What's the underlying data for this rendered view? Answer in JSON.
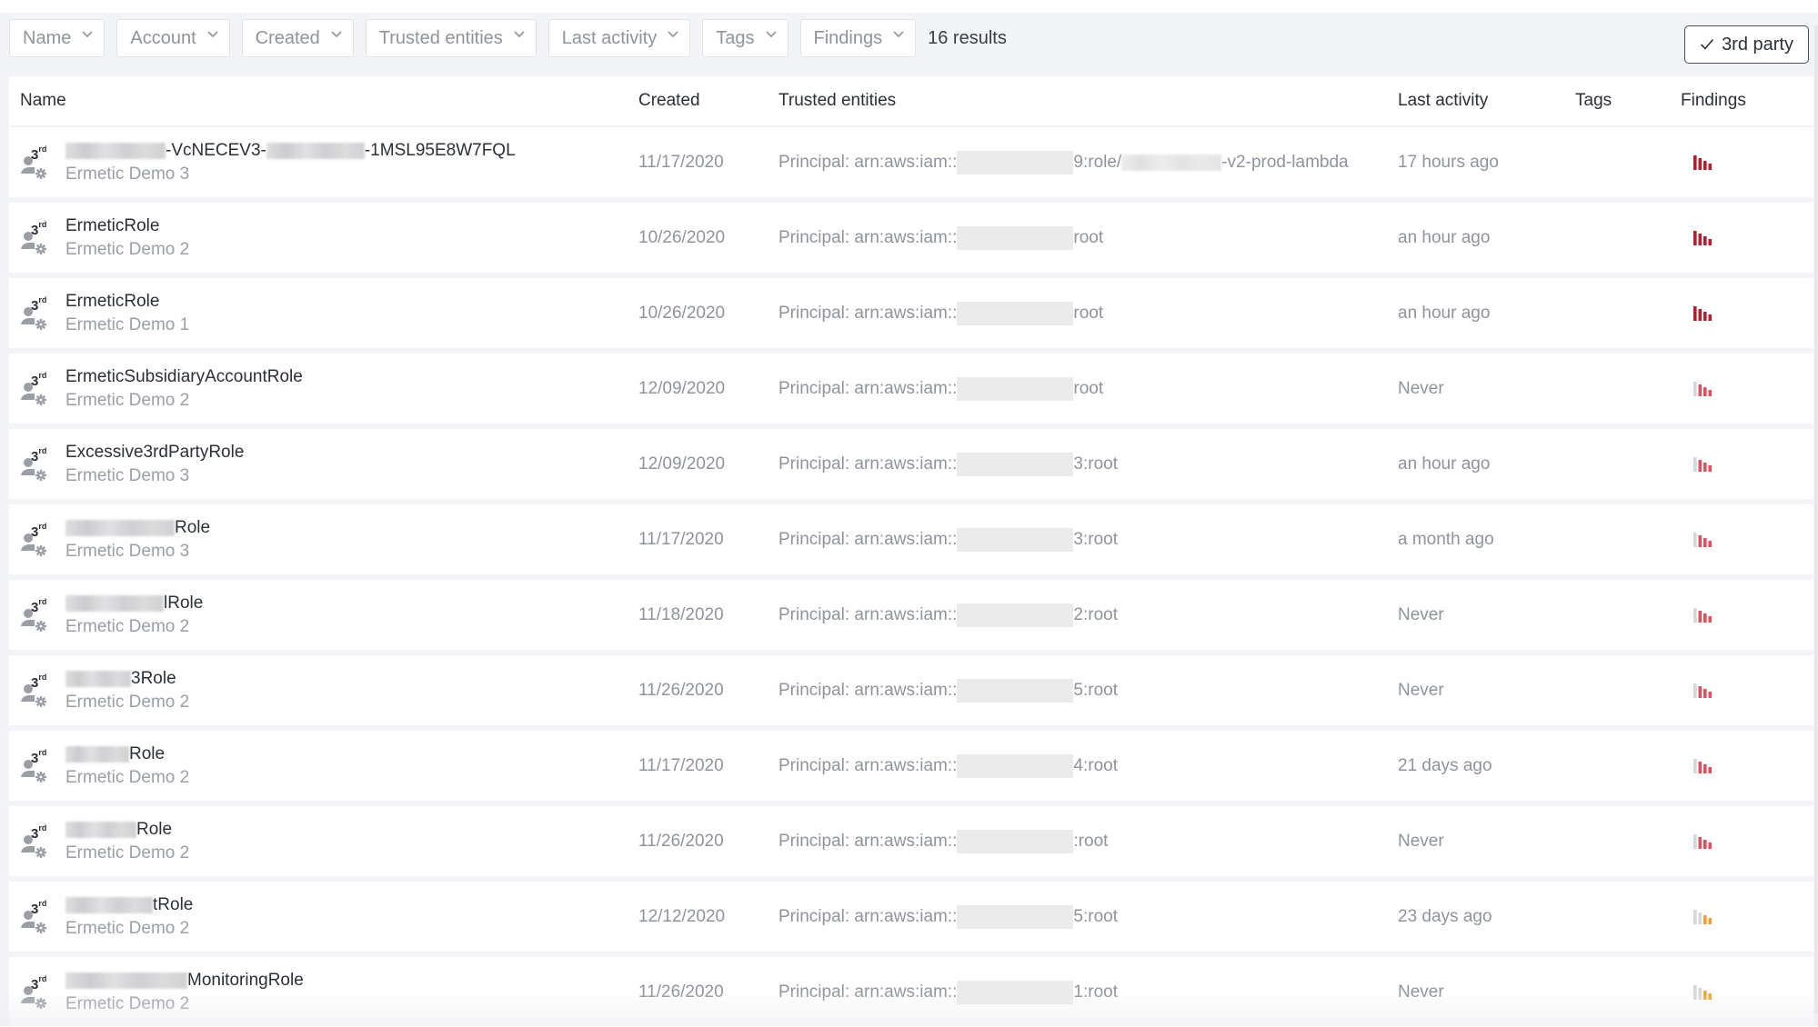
{
  "filters": {
    "items": [
      {
        "label": "Name"
      },
      {
        "label": "Account"
      },
      {
        "label": "Created"
      },
      {
        "label": "Trusted entities"
      },
      {
        "label": "Last activity"
      },
      {
        "label": "Tags"
      },
      {
        "label": "Findings"
      }
    ],
    "results_count": "16 results",
    "toggle_label": "3rd party",
    "toggle_checked": true
  },
  "table": {
    "columns": [
      "Name",
      "Created",
      "Trusted entities",
      "Last activity",
      "Tags",
      "Findings"
    ],
    "icon": "third-party-role-icon",
    "third_label": "3",
    "third_suffix": "rd",
    "rows": [
      {
        "name_prefix_redacted": true,
        "name": "-VcNECEV3-",
        "name_suffix": "-1MSL95E8W7FQL",
        "account": "Ermetic Demo 3",
        "created": "11/17/2020",
        "trust_prefix": "Principal: arn:aws:iam::",
        "trust_suffix": "9:role/",
        "trust_tail": "-v2-prod-lambda",
        "last_activity": "17 hours ago",
        "tags": "",
        "findings_severity": "critical",
        "findings_colors": [
          "#b5202e",
          "#b5202e",
          "#b5202e",
          "#b5202e"
        ]
      },
      {
        "name": "ErmeticRole",
        "account": "Ermetic Demo 2",
        "created": "10/26/2020",
        "trust_prefix": "Principal: arn:aws:iam::",
        "trust_suffix": "root",
        "last_activity": "an hour ago",
        "tags": "",
        "findings_severity": "critical",
        "findings_colors": [
          "#b5202e",
          "#b5202e",
          "#b5202e",
          "#b5202e"
        ]
      },
      {
        "name": "ErmeticRole",
        "account": "Ermetic Demo 1",
        "created": "10/26/2020",
        "trust_prefix": "Principal: arn:aws:iam::",
        "trust_suffix": "root",
        "last_activity": "an hour ago",
        "tags": "",
        "findings_severity": "critical",
        "findings_colors": [
          "#b5202e",
          "#b5202e",
          "#b5202e",
          "#b5202e"
        ]
      },
      {
        "name": "ErmeticSubsidiaryAccountRole",
        "account": "Ermetic Demo 2",
        "created": "12/09/2020",
        "trust_prefix": "Principal: arn:aws:iam::",
        "trust_suffix": "root",
        "last_activity": "Never",
        "tags": "",
        "findings_severity": "high",
        "findings_colors": [
          "#d4d6da",
          "#e0505e",
          "#e0505e",
          "#e0505e"
        ]
      },
      {
        "name": "Excessive3rdPartyRole",
        "account": "Ermetic Demo 3",
        "created": "12/09/2020",
        "trust_prefix": "Principal: arn:aws:iam::",
        "trust_suffix": "3:root",
        "last_activity": "an hour ago",
        "tags": "",
        "findings_severity": "high",
        "findings_colors": [
          "#d4d6da",
          "#e0505e",
          "#e0505e",
          "#e0505e"
        ]
      },
      {
        "name_prefix_redacted": true,
        "name": "Role",
        "account": "Ermetic Demo 3",
        "created": "11/17/2020",
        "trust_prefix": "Principal: arn:aws:iam::",
        "trust_suffix": "3:root",
        "last_activity": "a month ago",
        "tags": "",
        "findings_severity": "high",
        "findings_colors": [
          "#d4d6da",
          "#e0505e",
          "#e0505e",
          "#e0505e"
        ]
      },
      {
        "name_prefix_redacted": true,
        "name": "lRole",
        "account": "Ermetic Demo 2",
        "created": "11/18/2020",
        "trust_prefix": "Principal: arn:aws:iam::",
        "trust_suffix": "2:root",
        "last_activity": "Never",
        "tags": "",
        "findings_severity": "high",
        "findings_colors": [
          "#d4d6da",
          "#e0505e",
          "#e0505e",
          "#e0505e"
        ]
      },
      {
        "name_prefix_redacted": true,
        "name": "3Role",
        "account": "Ermetic Demo 2",
        "created": "11/26/2020",
        "trust_prefix": "Principal: arn:aws:iam::",
        "trust_suffix": "5:root",
        "last_activity": "Never",
        "tags": "",
        "findings_severity": "high",
        "findings_colors": [
          "#d4d6da",
          "#e0505e",
          "#e0505e",
          "#e0505e"
        ]
      },
      {
        "name_prefix_redacted": true,
        "name": "Role",
        "account": "Ermetic Demo 2",
        "created": "11/17/2020",
        "trust_prefix": "Principal: arn:aws:iam::",
        "trust_suffix": "4:root",
        "last_activity": "21 days ago",
        "tags": "",
        "findings_severity": "high",
        "findings_colors": [
          "#d4d6da",
          "#e0505e",
          "#e0505e",
          "#e0505e"
        ]
      },
      {
        "name_prefix_redacted": true,
        "name": "Role",
        "account": "Ermetic Demo 2",
        "created": "11/26/2020",
        "trust_prefix": "Principal: arn:aws:iam::",
        "trust_suffix": ":root",
        "last_activity": "Never",
        "tags": "",
        "findings_severity": "high",
        "findings_colors": [
          "#d4d6da",
          "#e0505e",
          "#e0505e",
          "#e0505e"
        ]
      },
      {
        "name_prefix_redacted": true,
        "name": "tRole",
        "account": "Ermetic Demo 2",
        "created": "12/12/2020",
        "trust_prefix": "Principal: arn:aws:iam::",
        "trust_suffix": "5:root",
        "last_activity": "23 days ago",
        "tags": "",
        "findings_severity": "medium",
        "findings_colors": [
          "#d4d6da",
          "#d4d6da",
          "#f0a030",
          "#f0a030"
        ]
      },
      {
        "name_prefix_redacted": true,
        "name": "MonitoringRole",
        "account": "Ermetic Demo 2",
        "created": "11/26/2020",
        "trust_prefix": "Principal: arn:aws:iam::",
        "trust_suffix": "1:root",
        "last_activity": "Never",
        "tags": "",
        "findings_severity": "medium",
        "findings_colors": [
          "#d4d6da",
          "#d4d6da",
          "#f0a030",
          "#f0a030"
        ]
      }
    ]
  }
}
